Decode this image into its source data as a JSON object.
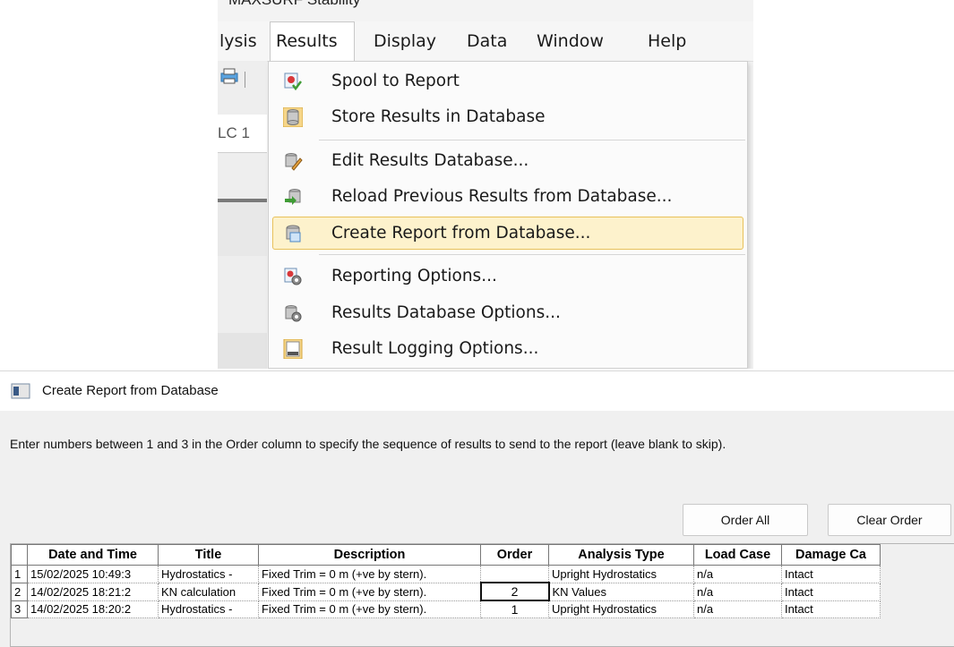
{
  "app": {
    "title": "MAXSURF Stability",
    "menubar": [
      {
        "label": "lysis"
      },
      {
        "label": "Results"
      },
      {
        "label": "Display"
      },
      {
        "label": "Data"
      },
      {
        "label": "Window"
      },
      {
        "label": "Help"
      }
    ],
    "tab_label": "LC 1"
  },
  "results_menu": {
    "items": [
      {
        "label": "Spool to Report",
        "icon": "spool-report-icon"
      },
      {
        "label": "Store Results in Database",
        "icon": "database-icon"
      },
      {
        "label": "Edit Results Database...",
        "icon": "edit-database-icon"
      },
      {
        "label": "Reload Previous Results from Database...",
        "icon": "reload-database-icon"
      },
      {
        "label": "Create Report from Database...",
        "icon": "create-report-icon",
        "highlighted": true
      },
      {
        "label": "Reporting Options...",
        "icon": "reporting-options-icon"
      },
      {
        "label": "Results Database Options...",
        "icon": "database-options-icon"
      },
      {
        "label": "Result Logging Options...",
        "icon": "log-icon"
      }
    ],
    "highlight_color": "#fdf2cc",
    "highlight_border": "#e8c15a"
  },
  "dialog": {
    "title": "Create Report from Database",
    "instructions": "Enter numbers between 1 and 3 in the Order column to specify the sequence of results to send to the report (leave blank to skip).",
    "buttons": {
      "order_all": "Order All",
      "clear_order": "Clear Order"
    },
    "columns": [
      "Date and Time",
      "Title",
      "Description",
      "Order",
      "Analysis Type",
      "Load Case",
      "Damage Ca"
    ],
    "rows": [
      {
        "num": "1",
        "date": "15/02/2025 10:49:3",
        "title": "Hydrostatics -",
        "description": "Fixed Trim = 0 m (+ve by stern).",
        "order": "",
        "analysis": "Upright Hydrostatics",
        "load_case": "n/a",
        "damage": "Intact"
      },
      {
        "num": "2",
        "date": "14/02/2025 18:21:2",
        "title": "KN calculation",
        "description": "Fixed Trim = 0 m (+ve by stern).",
        "order": "2",
        "analysis": "KN Values",
        "load_case": "n/a",
        "damage": "Intact"
      },
      {
        "num": "3",
        "date": "14/02/2025 18:20:2",
        "title": "Hydrostatics -",
        "description": "Fixed Trim = 0 m (+ve by stern).",
        "order": "1",
        "analysis": "Upright Hydrostatics",
        "load_case": "n/a",
        "damage": "Intact"
      }
    ]
  }
}
